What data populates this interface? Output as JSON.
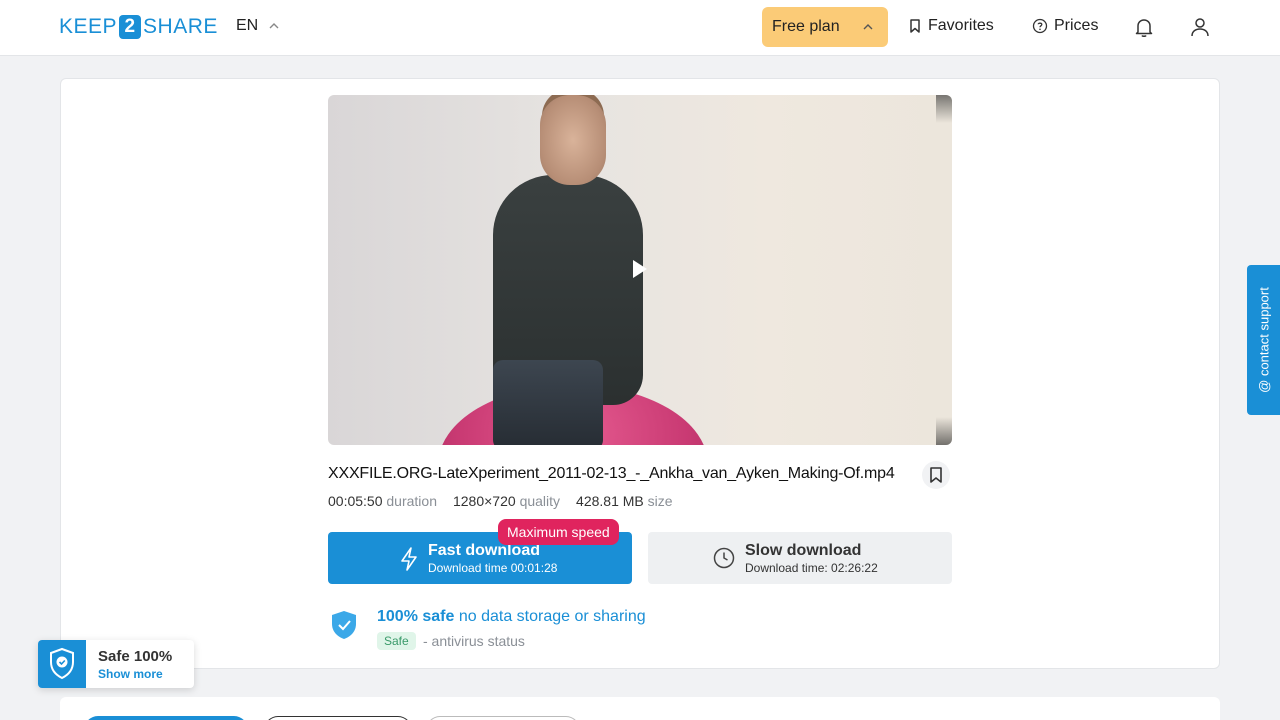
{
  "header": {
    "logo_left": "KEEP",
    "logo_num": "2",
    "logo_right": "SHARE",
    "language": "EN",
    "plan_label": "Free plan",
    "favorites_label": "Favorites",
    "prices_label": "Prices"
  },
  "file": {
    "name": "XXXFILE.ORG-LateXperiment_2011-02-13_-_Ankha_van_Ayken_Making-Of.mp4",
    "duration_value": "00:05:50",
    "duration_label": "duration",
    "quality_value": "1280×720",
    "quality_label": "quality",
    "size_value": "428.81 MB",
    "size_label": "size"
  },
  "download": {
    "fast_title": "Fast download",
    "fast_time": "Download time 00:01:28",
    "speed_badge": "Maximum speed",
    "slow_title": "Slow download",
    "slow_time": "Download time: 02:26:22"
  },
  "safety": {
    "bold": "100% safe",
    "note": "no data storage or sharing",
    "badge": "Safe",
    "status": "- antivirus status"
  },
  "support_label": "@ contact support",
  "toast": {
    "title": "Safe 100%",
    "link": "Show more"
  },
  "colors": {
    "accent": "#1a8fd6",
    "plan": "#fbcb77",
    "badge": "#e0245e"
  }
}
